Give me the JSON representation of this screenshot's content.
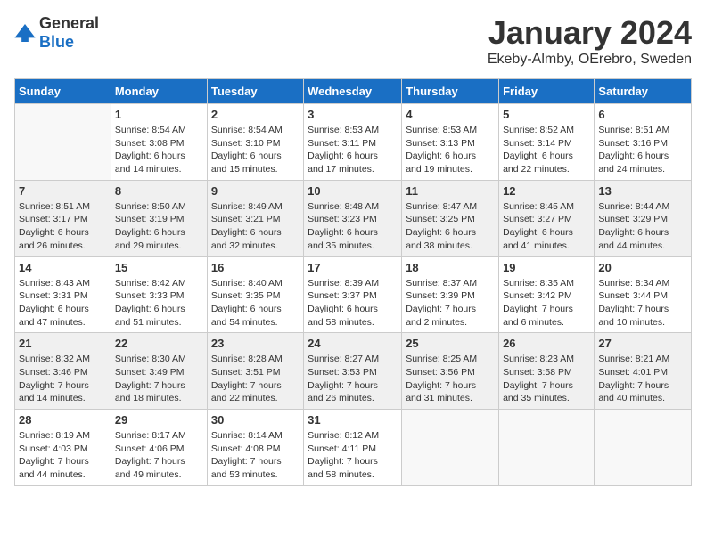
{
  "header": {
    "logo": {
      "general": "General",
      "blue": "Blue"
    },
    "title": "January 2024",
    "location": "Ekeby-Almby, OErebro, Sweden"
  },
  "weekdays": [
    "Sunday",
    "Monday",
    "Tuesday",
    "Wednesday",
    "Thursday",
    "Friday",
    "Saturday"
  ],
  "weeks": [
    [
      {
        "day": "",
        "info": ""
      },
      {
        "day": "1",
        "info": "Sunrise: 8:54 AM\nSunset: 3:08 PM\nDaylight: 6 hours\nand 14 minutes."
      },
      {
        "day": "2",
        "info": "Sunrise: 8:54 AM\nSunset: 3:10 PM\nDaylight: 6 hours\nand 15 minutes."
      },
      {
        "day": "3",
        "info": "Sunrise: 8:53 AM\nSunset: 3:11 PM\nDaylight: 6 hours\nand 17 minutes."
      },
      {
        "day": "4",
        "info": "Sunrise: 8:53 AM\nSunset: 3:13 PM\nDaylight: 6 hours\nand 19 minutes."
      },
      {
        "day": "5",
        "info": "Sunrise: 8:52 AM\nSunset: 3:14 PM\nDaylight: 6 hours\nand 22 minutes."
      },
      {
        "day": "6",
        "info": "Sunrise: 8:51 AM\nSunset: 3:16 PM\nDaylight: 6 hours\nand 24 minutes."
      }
    ],
    [
      {
        "day": "7",
        "info": "Sunrise: 8:51 AM\nSunset: 3:17 PM\nDaylight: 6 hours\nand 26 minutes."
      },
      {
        "day": "8",
        "info": "Sunrise: 8:50 AM\nSunset: 3:19 PM\nDaylight: 6 hours\nand 29 minutes."
      },
      {
        "day": "9",
        "info": "Sunrise: 8:49 AM\nSunset: 3:21 PM\nDaylight: 6 hours\nand 32 minutes."
      },
      {
        "day": "10",
        "info": "Sunrise: 8:48 AM\nSunset: 3:23 PM\nDaylight: 6 hours\nand 35 minutes."
      },
      {
        "day": "11",
        "info": "Sunrise: 8:47 AM\nSunset: 3:25 PM\nDaylight: 6 hours\nand 38 minutes."
      },
      {
        "day": "12",
        "info": "Sunrise: 8:45 AM\nSunset: 3:27 PM\nDaylight: 6 hours\nand 41 minutes."
      },
      {
        "day": "13",
        "info": "Sunrise: 8:44 AM\nSunset: 3:29 PM\nDaylight: 6 hours\nand 44 minutes."
      }
    ],
    [
      {
        "day": "14",
        "info": "Sunrise: 8:43 AM\nSunset: 3:31 PM\nDaylight: 6 hours\nand 47 minutes."
      },
      {
        "day": "15",
        "info": "Sunrise: 8:42 AM\nSunset: 3:33 PM\nDaylight: 6 hours\nand 51 minutes."
      },
      {
        "day": "16",
        "info": "Sunrise: 8:40 AM\nSunset: 3:35 PM\nDaylight: 6 hours\nand 54 minutes."
      },
      {
        "day": "17",
        "info": "Sunrise: 8:39 AM\nSunset: 3:37 PM\nDaylight: 6 hours\nand 58 minutes."
      },
      {
        "day": "18",
        "info": "Sunrise: 8:37 AM\nSunset: 3:39 PM\nDaylight: 7 hours\nand 2 minutes."
      },
      {
        "day": "19",
        "info": "Sunrise: 8:35 AM\nSunset: 3:42 PM\nDaylight: 7 hours\nand 6 minutes."
      },
      {
        "day": "20",
        "info": "Sunrise: 8:34 AM\nSunset: 3:44 PM\nDaylight: 7 hours\nand 10 minutes."
      }
    ],
    [
      {
        "day": "21",
        "info": "Sunrise: 8:32 AM\nSunset: 3:46 PM\nDaylight: 7 hours\nand 14 minutes."
      },
      {
        "day": "22",
        "info": "Sunrise: 8:30 AM\nSunset: 3:49 PM\nDaylight: 7 hours\nand 18 minutes."
      },
      {
        "day": "23",
        "info": "Sunrise: 8:28 AM\nSunset: 3:51 PM\nDaylight: 7 hours\nand 22 minutes."
      },
      {
        "day": "24",
        "info": "Sunrise: 8:27 AM\nSunset: 3:53 PM\nDaylight: 7 hours\nand 26 minutes."
      },
      {
        "day": "25",
        "info": "Sunrise: 8:25 AM\nSunset: 3:56 PM\nDaylight: 7 hours\nand 31 minutes."
      },
      {
        "day": "26",
        "info": "Sunrise: 8:23 AM\nSunset: 3:58 PM\nDaylight: 7 hours\nand 35 minutes."
      },
      {
        "day": "27",
        "info": "Sunrise: 8:21 AM\nSunset: 4:01 PM\nDaylight: 7 hours\nand 40 minutes."
      }
    ],
    [
      {
        "day": "28",
        "info": "Sunrise: 8:19 AM\nSunset: 4:03 PM\nDaylight: 7 hours\nand 44 minutes."
      },
      {
        "day": "29",
        "info": "Sunrise: 8:17 AM\nSunset: 4:06 PM\nDaylight: 7 hours\nand 49 minutes."
      },
      {
        "day": "30",
        "info": "Sunrise: 8:14 AM\nSunset: 4:08 PM\nDaylight: 7 hours\nand 53 minutes."
      },
      {
        "day": "31",
        "info": "Sunrise: 8:12 AM\nSunset: 4:11 PM\nDaylight: 7 hours\nand 58 minutes."
      },
      {
        "day": "",
        "info": ""
      },
      {
        "day": "",
        "info": ""
      },
      {
        "day": "",
        "info": ""
      }
    ]
  ]
}
